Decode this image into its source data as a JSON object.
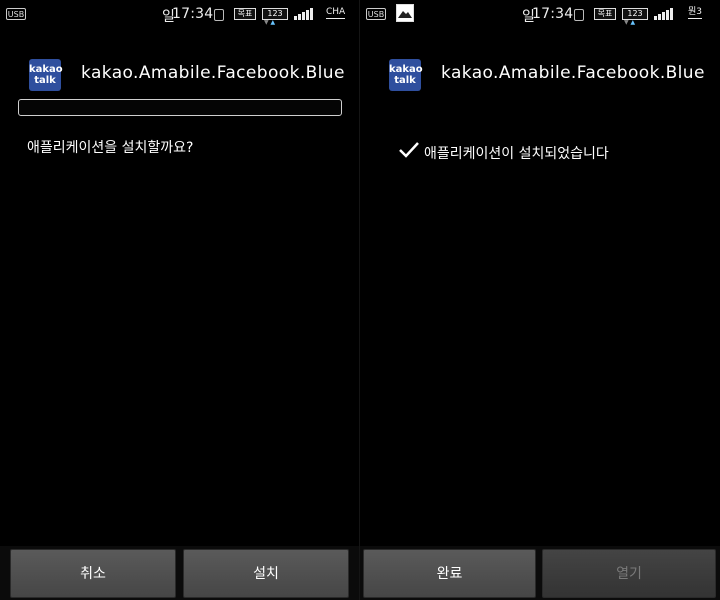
{
  "left_screen": {
    "status_bar": {
      "usb_icon": "usb-icon",
      "lunar_text": "일",
      "time": "17:34",
      "vibrate_icon": "vibrate-icon",
      "box1": "목표",
      "box2": "123",
      "signal_icon": "signal-icon",
      "carrier_label": "CHA"
    },
    "app": {
      "icon_text_line1": "kakao",
      "icon_text_line2": "talk",
      "name": "kakao.Amabile.Facebook.Blue"
    },
    "progress": {
      "fraction": 0.0
    },
    "message": "애플리케이션을 설치할까요?",
    "buttons": {
      "cancel": "취소",
      "install": "설치"
    }
  },
  "right_screen": {
    "status_bar": {
      "usb_icon": "usb-icon",
      "image_icon": "image-notification-icon",
      "lunar_text": "일",
      "time": "17:34",
      "vibrate_icon": "vibrate-icon",
      "box1": "목표",
      "box2": "123",
      "signal_icon": "signal-icon",
      "carrier_label": "뭔3"
    },
    "app": {
      "icon_text_line1": "kakao",
      "icon_text_line2": "talk",
      "name": "kakao.Amabile.Facebook.Blue"
    },
    "message": "애플리케이션이 설치되었습니다",
    "buttons": {
      "done": "완료",
      "open": "열기"
    }
  },
  "colors": {
    "background": "#000000",
    "button": "#4f4f4f",
    "kakao_icon": "#2f4f9e",
    "upload_arrow": "#6ac5ff"
  }
}
